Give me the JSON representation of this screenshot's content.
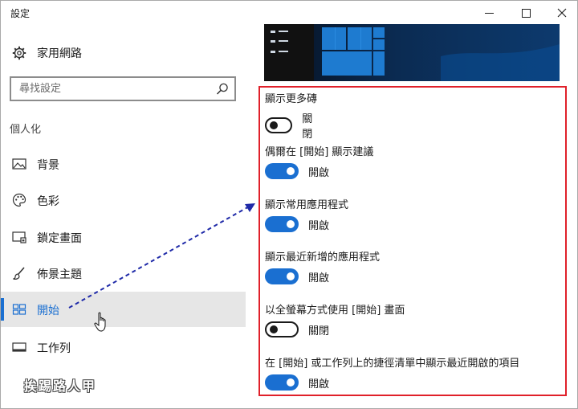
{
  "window": {
    "title": "設定"
  },
  "sidebar": {
    "home_label": "家用網路",
    "search_placeholder": "尋找設定",
    "section_label": "個人化",
    "items": [
      {
        "label": "背景",
        "icon": "picture-icon"
      },
      {
        "label": "色彩",
        "icon": "palette-icon"
      },
      {
        "label": "鎖定畫面",
        "icon": "lock-screen-icon"
      },
      {
        "label": "佈景主題",
        "icon": "theme-brush-icon"
      },
      {
        "label": "開始",
        "icon": "start-grid-icon",
        "selected": true
      },
      {
        "label": "工作列",
        "icon": "taskbar-icon"
      }
    ]
  },
  "settings": [
    {
      "title": "顯示更多磚",
      "on": false,
      "state": "關閉"
    },
    {
      "title": "偶爾在 [開始] 顯示建議",
      "on": true,
      "state": "開啟"
    },
    {
      "title": "顯示常用應用程式",
      "on": true,
      "state": "開啟"
    },
    {
      "title": "顯示最近新增的應用程式",
      "on": true,
      "state": "開啟"
    },
    {
      "title": "以全螢幕方式使用 [開始] 畫面",
      "on": false,
      "state": "關閉"
    },
    {
      "title": "在 [開始] 或工作列上的捷徑清單中顯示最近開啟的項目",
      "on": true,
      "state": "開啟"
    }
  ],
  "watermark": "挨踢路人甲",
  "colors": {
    "accent": "#1a6fd1",
    "highlight_border": "#e0202a",
    "selected_bg": "#e6e6e6"
  }
}
